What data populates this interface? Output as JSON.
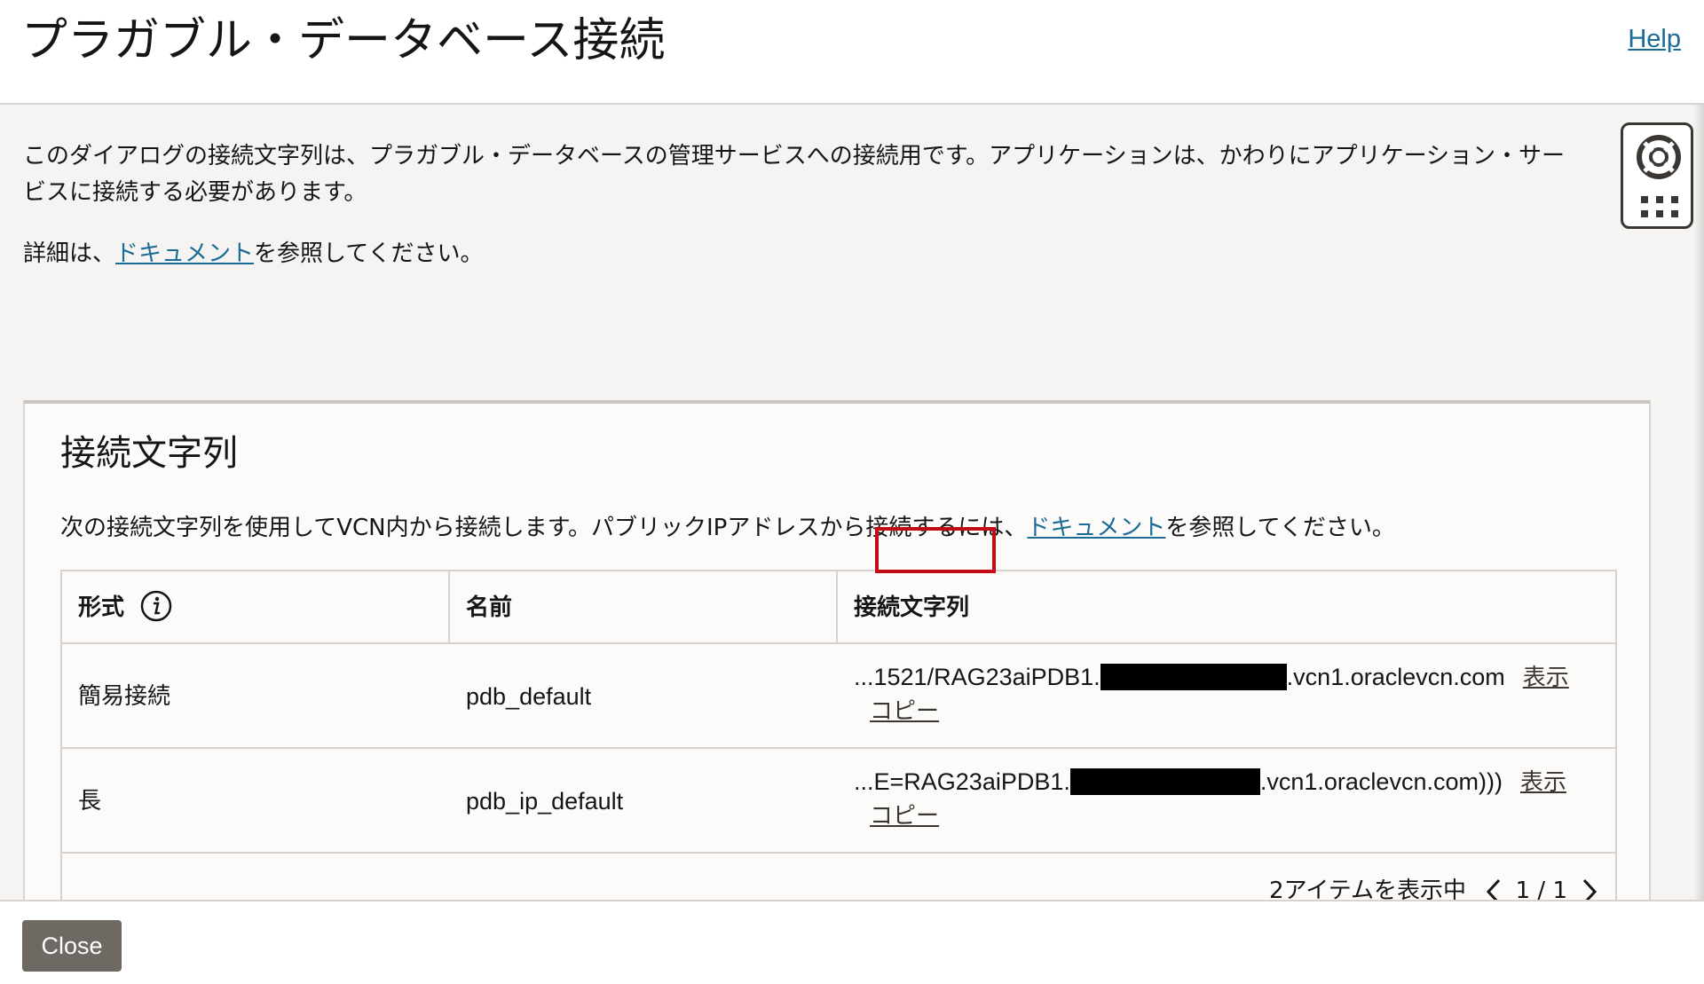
{
  "header": {
    "title": "プラガブル・データベース接続",
    "help_label": "Help"
  },
  "intro": {
    "line1": "このダイアログの接続文字列は、プラガブル・データベースの管理サービスへの接続用です。アプリケーションは、かわりにアプリケーション・サー",
    "line2": "ビスに接続する必要があります。",
    "detail_prefix": "詳細は、",
    "detail_link": "ドキュメント",
    "detail_suffix": "を参照してください。"
  },
  "card": {
    "title": "接続文字列",
    "desc_prefix": "次の接続文字列を使用してVCN内から接続します。パブリックIPアドレスから接続するには、",
    "desc_link": "ドキュメント",
    "desc_suffix": "を参照してください。"
  },
  "table": {
    "columns": [
      "形式",
      "名前",
      "接続文字列"
    ],
    "rows": [
      {
        "format": "簡易接続",
        "name": "pdb_default",
        "conn_prefix": "...1521/RAG23aiPDB1.",
        "conn_suffix": ".vcn1.oraclevcn.com",
        "show_label": "表示",
        "copy_label": "コピー"
      },
      {
        "format": "長",
        "name": "pdb_ip_default",
        "conn_prefix": "...E=RAG23aiPDB1.",
        "conn_suffix": ".vcn1.oraclevcn.com)))",
        "show_label": "表示",
        "copy_label": "コピー"
      }
    ],
    "item_count": "2アイテムを表示中",
    "page": "1 / 1"
  },
  "footer": {
    "close_label": "Close"
  },
  "icons": {
    "info": "info-icon",
    "help_widget": "lifebuoy-icon",
    "apps": "grid-dots-icon",
    "prev": "chevron-left-icon",
    "next": "chevron-right-icon"
  },
  "colors": {
    "link": "#1a6c96",
    "highlight": "#c20b14",
    "close_button": "#6f6964"
  }
}
